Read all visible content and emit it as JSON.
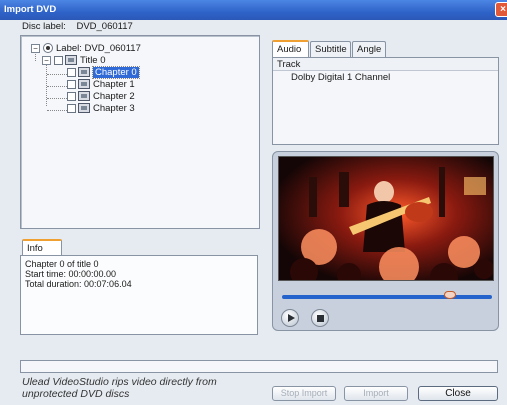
{
  "window": {
    "title": "Import DVD",
    "close_glyph": "×"
  },
  "disc": {
    "label_caption": "Disc label:",
    "label_value": "DVD_060117"
  },
  "tree": {
    "root": "Label: DVD_060117",
    "title": "Title 0",
    "chapters": [
      "Chapter 0",
      "Chapter 1",
      "Chapter 2",
      "Chapter 3"
    ],
    "selected_index": 0
  },
  "info": {
    "tab": "Info",
    "lines": [
      "Chapter 0 of title 0",
      "Start time: 00:00:00.00",
      "Total duration: 00:07:06.04"
    ]
  },
  "tabs": {
    "items": [
      "Audio",
      "Subtitle",
      "Angle"
    ],
    "active": "Audio"
  },
  "track": {
    "header": "Track",
    "rows": [
      "Dolby Digital 1 Channel"
    ]
  },
  "player": {
    "scrub_position": 0.8,
    "play_icon": "play-icon",
    "stop_icon": "stop-icon"
  },
  "footer": {
    "caption": "Ulead VideoStudio rips video directly from unprotected DVD discs",
    "stop_import": "Stop Import",
    "import": "Import",
    "close": "Close"
  },
  "colors": {
    "accent": "#2f63c8",
    "selection": "#2f6ad6",
    "tab_highlight": "#f0a030"
  }
}
